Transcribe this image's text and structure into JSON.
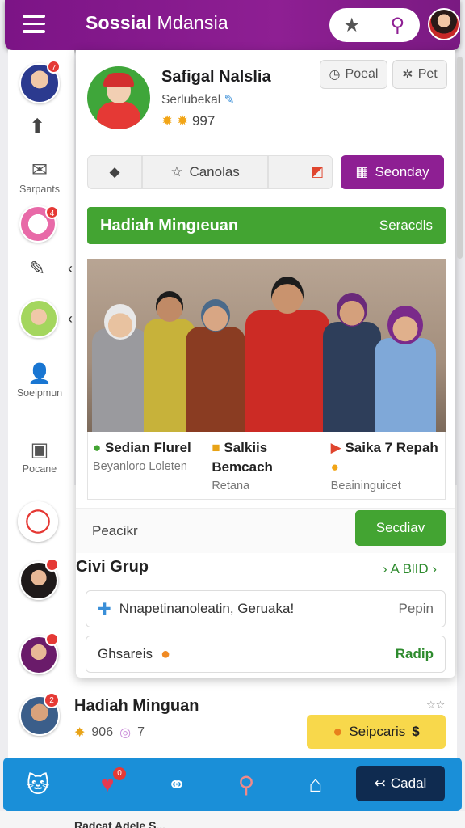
{
  "app": {
    "title_bold": "Sossial",
    "title_rest": "Mdansia"
  },
  "topbar": {
    "menu_icon": "hamburger-icon",
    "star_icon": "star-icon",
    "link_icon": "link-icon"
  },
  "rail": {
    "items": [
      {
        "label": "Sarpants",
        "icon": "envelope-icon"
      },
      {
        "label": "Soeipmun",
        "icon": "person-icon"
      },
      {
        "label": "Pocane",
        "icon": "square-icon"
      }
    ],
    "badges": [
      "7",
      "4"
    ]
  },
  "profile": {
    "name": "Safigal Nalslia",
    "subtitle": "Serlubekal",
    "stat_value": "997",
    "btn_poeal": "Poeal",
    "btn_pet": "Pet"
  },
  "segment": {
    "item2": "Canolas",
    "item4": "Seonday"
  },
  "weekly_banner": {
    "title": "Hadiah Mingıeuan",
    "action": "Seracdls"
  },
  "photo": {
    "alt": "group-photo"
  },
  "info": [
    {
      "title": "Sedian Flurel",
      "sub": "Beyanloro Loleten",
      "icon": "chat-icon"
    },
    {
      "title": "Salkiis Bemcach",
      "sub": "Retana",
      "icon": "box-icon"
    },
    {
      "title": "Saika 7 Repah",
      "sub": "Beaininguicet",
      "icon": "play-icon"
    }
  ],
  "action_row": {
    "label": "Peacikr",
    "button": "Secdiav"
  },
  "group": {
    "title": "Civi Grup",
    "link": "› A BlID ›"
  },
  "rows": [
    {
      "text": "Nnapetinanoleatin, Geruaka!",
      "action": "Pepin"
    },
    {
      "text": "Ghsareis",
      "action": "Radip"
    }
  ],
  "feed": {
    "title": "Hadiah Minguan",
    "stats": "906",
    "stats2": "7",
    "cta": "Seipcaris",
    "cta_suffix": "$"
  },
  "nav": {
    "cta": "Cadal",
    "badge": "0"
  },
  "bottom": {
    "text": "Radcat Adele S..."
  },
  "colors": {
    "brand": "#8e1f93",
    "accent_green": "#43a432",
    "nav_blue": "#1a8fd8"
  }
}
